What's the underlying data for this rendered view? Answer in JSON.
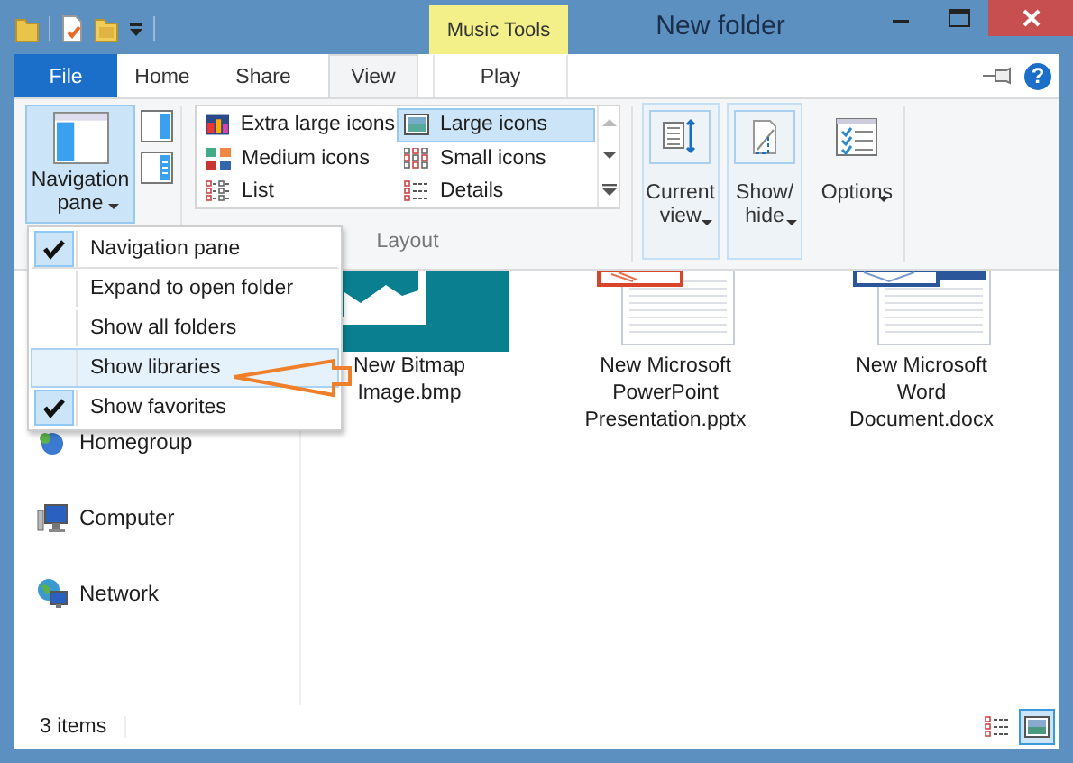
{
  "window": {
    "title": "New folder",
    "contextual_tab": "Music Tools"
  },
  "ribbon_tabs": [
    {
      "label": "File",
      "kind": "file",
      "selected": false
    },
    {
      "label": "Home",
      "kind": "normal",
      "selected": false
    },
    {
      "label": "Share",
      "kind": "normal",
      "selected": false
    },
    {
      "label": "View",
      "kind": "normal",
      "selected": true
    },
    {
      "label": "Play",
      "kind": "contextual",
      "selected": false
    }
  ],
  "help": "?",
  "navigation_pane_button": {
    "label_lines": [
      "Navigation",
      "pane"
    ],
    "selected": true
  },
  "layout": {
    "group_label": "Layout",
    "options": [
      {
        "label": "Extra large icons",
        "kind": "extra_large",
        "selected": false
      },
      {
        "label": "Large icons",
        "kind": "large",
        "selected": true
      },
      {
        "label": "Medium icons",
        "kind": "medium",
        "selected": false
      },
      {
        "label": "Small icons",
        "kind": "small",
        "selected": false
      },
      {
        "label": "List",
        "kind": "list",
        "selected": false
      },
      {
        "label": "Details",
        "kind": "details",
        "selected": false
      }
    ]
  },
  "view_buttons": [
    {
      "label_lines": [
        "Current",
        "view"
      ],
      "kind": "current_view",
      "selected": true
    },
    {
      "label_lines": [
        "Show/",
        "hide"
      ],
      "kind": "show_hide",
      "selected": true
    },
    {
      "label_lines": [
        "Options"
      ],
      "kind": "options",
      "selected": false
    }
  ],
  "navigation_menu": [
    {
      "label": "Navigation pane",
      "checked": true,
      "selected": false
    },
    {
      "label": "Expand to open folder",
      "checked": false,
      "selected": false
    },
    {
      "label": "Show all folders",
      "checked": false,
      "selected": false
    },
    {
      "label": "Show libraries",
      "checked": false,
      "selected": true
    },
    {
      "label": "Show favorites",
      "checked": true,
      "selected": false
    }
  ],
  "sidebar": {
    "items": [
      {
        "label": "Homegroup",
        "kind": "homegroup"
      },
      {
        "label": "Computer",
        "kind": "computer"
      },
      {
        "label": "Network",
        "kind": "network"
      }
    ]
  },
  "files": [
    {
      "name_lines": [
        "New Bitmap",
        "Image.bmp"
      ],
      "kind": "bitmap"
    },
    {
      "name_lines": [
        "New Microsoft",
        "PowerPoint",
        "Presentation.pptx"
      ],
      "kind": "powerpoint"
    },
    {
      "name_lines": [
        "New Microsoft",
        "Word",
        "Document.docx"
      ],
      "kind": "word"
    }
  ],
  "status_bar": {
    "text": "3 items",
    "view_buttons": [
      {
        "kind": "details",
        "selected": false
      },
      {
        "kind": "large_icons",
        "selected": true
      }
    ]
  }
}
